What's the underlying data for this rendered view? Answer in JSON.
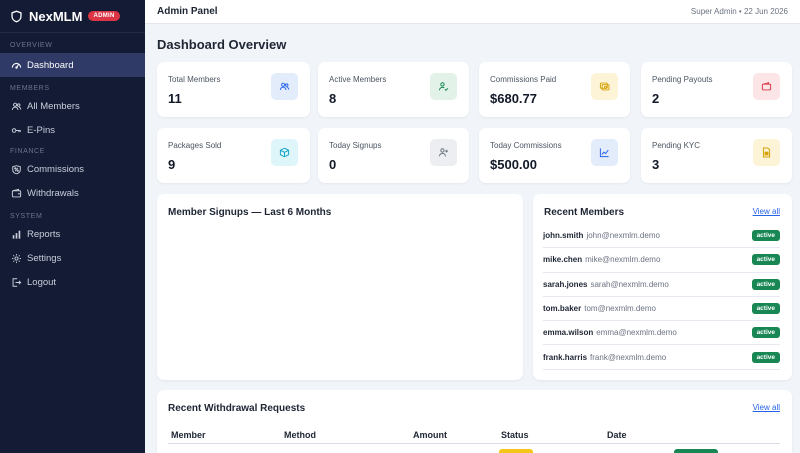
{
  "brand": {
    "name": "NexMLM",
    "badge": "ADMIN"
  },
  "sidebar": {
    "sections": [
      {
        "label": "OVERVIEW",
        "items": [
          {
            "label": "Dashboard",
            "icon": "dashboard-icon",
            "active": true
          }
        ]
      },
      {
        "label": "MEMBERS",
        "items": [
          {
            "label": "All Members",
            "icon": "users-icon"
          },
          {
            "label": "E-Pins",
            "icon": "key-icon"
          }
        ]
      },
      {
        "label": "FINANCE",
        "items": [
          {
            "label": "Commissions",
            "icon": "percent-icon"
          },
          {
            "label": "Withdrawals",
            "icon": "wallet-icon"
          }
        ]
      },
      {
        "label": "SYSTEM",
        "items": [
          {
            "label": "Reports",
            "icon": "bar-chart-icon"
          },
          {
            "label": "Settings",
            "icon": "gear-icon"
          },
          {
            "label": "Logout",
            "icon": "logout-icon"
          }
        ]
      }
    ]
  },
  "topbar": {
    "title": "Admin Panel",
    "meta": "Super Admin • 22 Jun 2026"
  },
  "page": {
    "title": "Dashboard Overview"
  },
  "stats": [
    {
      "label": "Total Members",
      "value": "11",
      "icon": "users-icon",
      "color": "#2563eb",
      "bg": "#e3ecfb"
    },
    {
      "label": "Active Members",
      "value": "8",
      "icon": "user-check-icon",
      "color": "#198754",
      "bg": "#e2f2e8"
    },
    {
      "label": "Commissions Paid",
      "value": "$680.77",
      "icon": "money-icon",
      "color": "#d4a106",
      "bg": "#fdf4d8"
    },
    {
      "label": "Pending Payouts",
      "value": "2",
      "icon": "wallet-icon",
      "color": "#dc3545",
      "bg": "#fbe5e7"
    },
    {
      "label": "Packages Sold",
      "value": "9",
      "icon": "box-icon",
      "color": "#0ea5c6",
      "bg": "#def6fa"
    },
    {
      "label": "Today Signups",
      "value": "0",
      "icon": "user-plus-icon",
      "color": "#6b7280",
      "bg": "#eceef1"
    },
    {
      "label": "Today Commissions",
      "value": "$500.00",
      "icon": "trend-icon",
      "color": "#2563eb",
      "bg": "#e3ecfb"
    },
    {
      "label": "Pending KYC",
      "value": "3",
      "icon": "document-icon",
      "color": "#d4a106",
      "bg": "#fdf4d8"
    }
  ],
  "signups": {
    "title": "Member Signups — Last 6 Months"
  },
  "recent_members": {
    "title": "Recent Members",
    "view_all": "View all",
    "rows": [
      {
        "username": "john.smith",
        "email": "john@nexmlm.demo",
        "status": "active"
      },
      {
        "username": "mike.chen",
        "email": "mike@nexmlm.demo",
        "status": "active"
      },
      {
        "username": "sarah.jones",
        "email": "sarah@nexmlm.demo",
        "status": "active"
      },
      {
        "username": "tom.baker",
        "email": "tom@nexmlm.demo",
        "status": "active"
      },
      {
        "username": "emma.wilson",
        "email": "emma@nexmlm.demo",
        "status": "active"
      },
      {
        "username": "frank.harris",
        "email": "frank@nexmlm.demo",
        "status": "active"
      }
    ]
  },
  "withdrawals": {
    "title": "Recent Withdrawal Requests",
    "view_all": "View all",
    "columns": [
      "Member",
      "Method",
      "Amount",
      "Status",
      "Date"
    ]
  }
}
